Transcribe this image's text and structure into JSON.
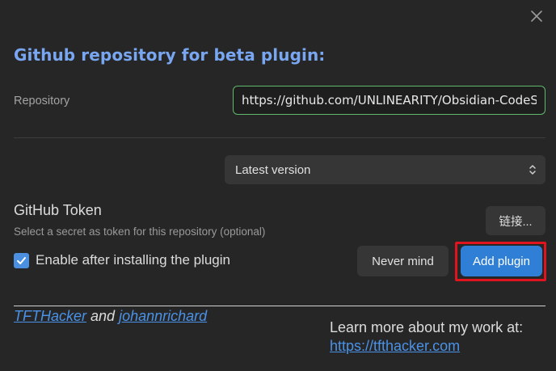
{
  "modal": {
    "title": "Github repository for beta plugin:",
    "close_icon": "close-icon"
  },
  "repository": {
    "label": "Repository",
    "value": "https://github.com/UNLINEARITY/Obsidian-CodeSp",
    "border_color": "#5fb86b"
  },
  "version": {
    "selected": "Latest version",
    "icon": "chevron-up-down-icon"
  },
  "token": {
    "title": "GitHub Token",
    "description": "Select a secret as token for this repository (optional)",
    "link_button_label": "链接..."
  },
  "enable": {
    "checked": true,
    "label": "Enable after installing the plugin"
  },
  "actions": {
    "never_mind_label": "Never mind",
    "add_plugin_label": "Add plugin",
    "accent_color": "#2f7fd6",
    "highlight_color": "#e0141e"
  },
  "footer": {
    "author1": "TFTHacker",
    "conjunction": "and",
    "author2": "johannrichard",
    "learn_more": "Learn more about my work at:",
    "learn_more_link": "https://tfthacker.com",
    "link_color": "#4a92e8"
  }
}
